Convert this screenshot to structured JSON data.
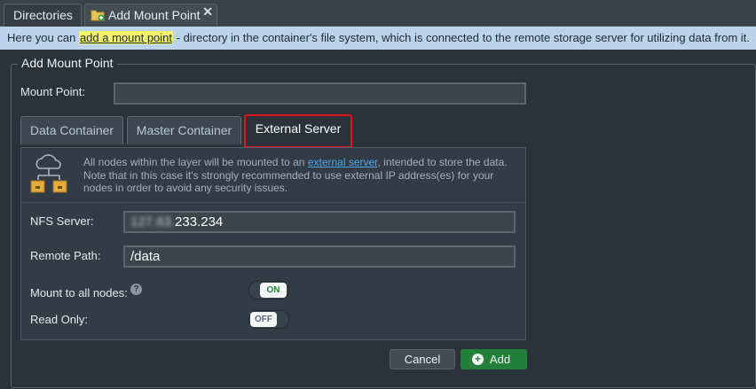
{
  "tabs": [
    {
      "label": "Directories"
    },
    {
      "label": "Add Mount Point",
      "close": "✕"
    }
  ],
  "infobar": {
    "prefix": "Here you can ",
    "link": "add a mount point",
    "suffix": " - directory in the container's file system, which is connected to the remote storage server for utilizing data from it."
  },
  "form": {
    "title": "Add Mount Point",
    "mount_point_label": "Mount Point:",
    "mount_point_value": ""
  },
  "subtabs": [
    {
      "label": "Data Container"
    },
    {
      "label": "Master Container"
    },
    {
      "label": "External Server",
      "active": true
    }
  ],
  "panel": {
    "desc_prefix": "All nodes within the layer will be mounted to an ",
    "desc_link": "external server",
    "desc_suffix": ", intended to store the data. Note that in this case it's strongly recommended to use external IP address(es) for your nodes in order to avoid any security issues.",
    "nfs_label": "NFS Server:",
    "nfs_value_blurred": "127.63.",
    "nfs_value": "233.234",
    "remote_label": "Remote Path:",
    "remote_value": "/data",
    "mount_all_label": "Mount to all nodes:",
    "mount_all_state": "ON",
    "read_only_label": "Read Only:",
    "read_only_state": "OFF",
    "help": "?"
  },
  "buttons": {
    "cancel": "Cancel",
    "add": "Add",
    "add_icon": "+"
  },
  "colors": {
    "background": "#2b323a",
    "infobar": "#bcd3ec",
    "highlight": "#f3f36b",
    "active_tab_border": "#e0161c",
    "add_button": "#23803a",
    "link": "#4ea7e6"
  }
}
